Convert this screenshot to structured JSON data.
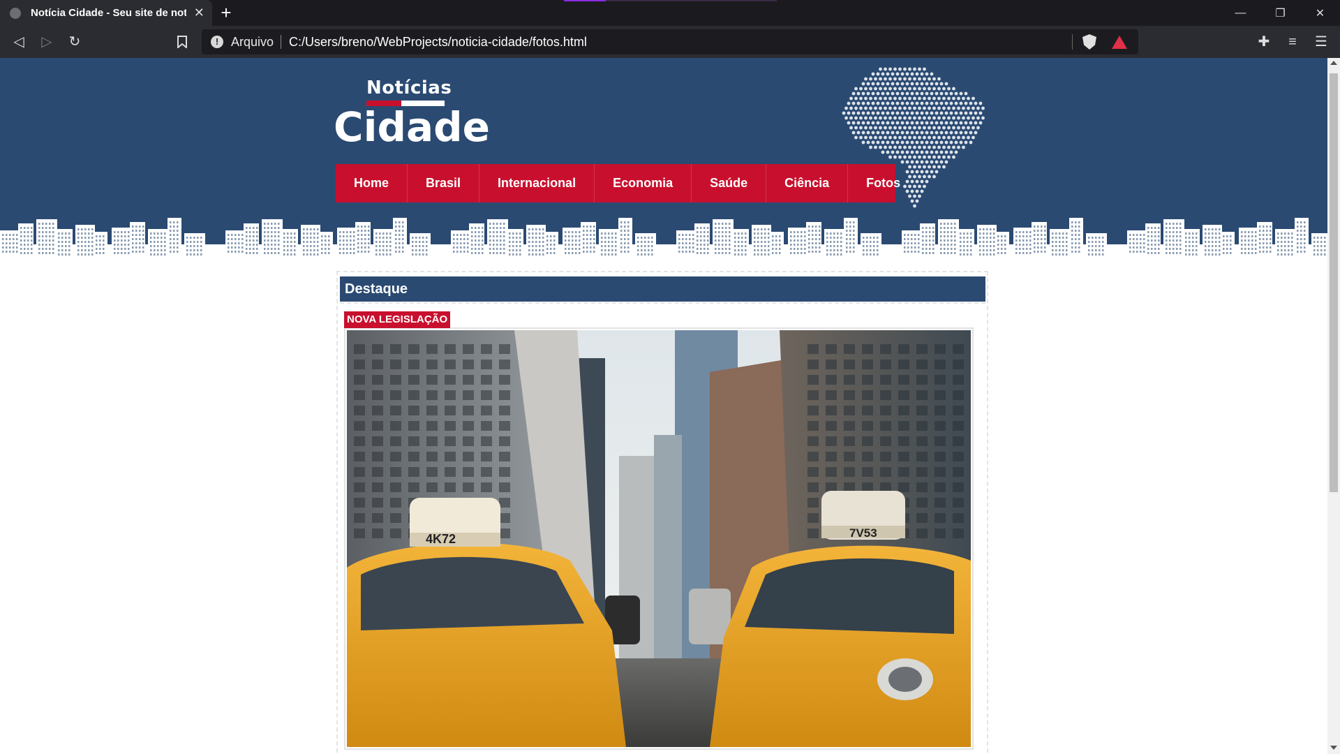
{
  "browser": {
    "tab_title": "Notícia Cidade - Seu site de notícias",
    "address_scheme": "Arquivo",
    "address_url": "C:/Users/breno/WebProjects/noticia-cidade/fotos.html",
    "icons": [
      "globe-icon",
      "close-icon",
      "plus-icon",
      "minimize-icon",
      "restore-icon",
      "back-icon",
      "forward-icon",
      "reload-icon",
      "bookmark-icon",
      "info-icon",
      "brave-shield-icon",
      "brave-rewards-icon",
      "extensions-icon",
      "playlist-icon",
      "menu-icon"
    ]
  },
  "site": {
    "logo_top": "Notícias",
    "logo_bottom": "Cidade",
    "nav": [
      "Home",
      "Brasil",
      "Internacional",
      "Economia",
      "Saúde",
      "Ciência",
      "Fotos"
    ],
    "colors": {
      "header_blue": "#2a4a72",
      "accent_red": "#c8102e"
    }
  },
  "featured": {
    "section_title": "Destaque",
    "tag": "NOVA LEGISLAÇÃO",
    "image_alt": "Táxis amarelos em uma avenida entre prédios",
    "taxi_left_plate": "4K72",
    "taxi_right_plate": "7V53"
  }
}
